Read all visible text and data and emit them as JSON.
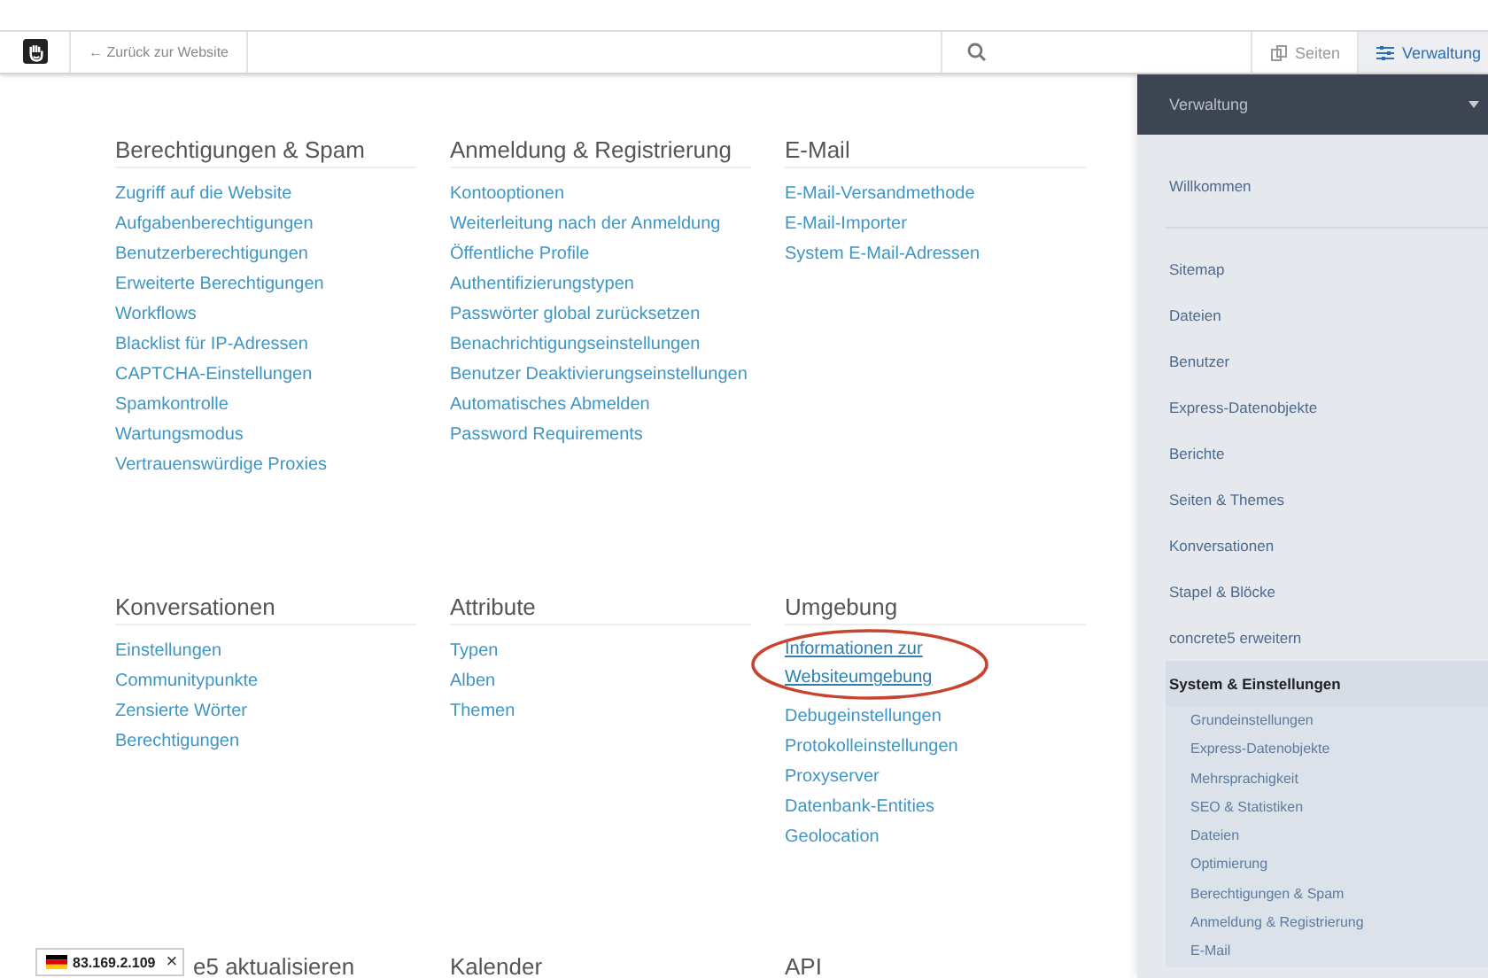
{
  "toolbar": {
    "back_link": "← Zurück zur Website",
    "buttons": [
      {
        "label": "Seiten",
        "kind": "pages",
        "selected": false
      },
      {
        "label": "Verwaltung",
        "kind": "dashboard",
        "selected": true
      }
    ]
  },
  "sections": [
    {
      "title": "Berechtigungen & Spam",
      "links": [
        {
          "label": "Zugriff auf die Website"
        },
        {
          "label": "Aufgabenberechtigungen"
        },
        {
          "label": "Benutzerberechtigungen"
        },
        {
          "label": "Erweiterte Berechtigungen"
        },
        {
          "label": "Workflows"
        },
        {
          "label": "Blacklist für IP-Adressen"
        },
        {
          "label": "CAPTCHA-Einstellungen"
        },
        {
          "label": "Spamkontrolle"
        },
        {
          "label": "Wartungsmodus"
        },
        {
          "label": "Vertrauenswürdige Proxies"
        }
      ]
    },
    {
      "title": "Anmeldung & Registrierung",
      "links": [
        {
          "label": "Kontooptionen"
        },
        {
          "label": "Weiterleitung nach der Anmeldung"
        },
        {
          "label": "Öffentliche Profile"
        },
        {
          "label": "Authentifizierungstypen"
        },
        {
          "label": "Passwörter global zurücksetzen"
        },
        {
          "label": "Benachrichtigungseinstellungen"
        },
        {
          "label": "Benutzer Deaktivierungseinstellungen"
        },
        {
          "label": "Automatisches Abmelden"
        },
        {
          "label": "Password Requirements"
        }
      ]
    },
    {
      "title": "E-Mail",
      "links": [
        {
          "label": "E-Mail-Versandmethode"
        },
        {
          "label": "E-Mail-Importer"
        },
        {
          "label": "System E-Mail-Adressen"
        }
      ]
    },
    {
      "title": "Konversationen",
      "links": [
        {
          "label": "Einstellungen"
        },
        {
          "label": "Communitypunkte"
        },
        {
          "label": "Zensierte Wörter"
        },
        {
          "label": "Berechtigungen"
        }
      ]
    },
    {
      "title": "Attribute",
      "links": [
        {
          "label": "Typen"
        },
        {
          "label": "Alben"
        },
        {
          "label": "Themen"
        }
      ]
    },
    {
      "title": "Umgebung",
      "links": [
        {
          "label": "Informationen zur Websiteumgebung",
          "circled": true
        },
        {
          "label": "Debugeinstellungen",
          "circled": false
        },
        {
          "label": "Protokolleinstellungen",
          "circled": false
        },
        {
          "label": "Proxyserver",
          "circled": false
        },
        {
          "label": "Datenbank-Entities",
          "circled": false
        },
        {
          "label": "Geolocation",
          "circled": false
        }
      ]
    },
    {
      "title": "e5 aktualisieren"
    },
    {
      "title": "Kalender"
    },
    {
      "title": "API"
    }
  ],
  "ip_badge": {
    "label": "83.169.2.109",
    "close": "×"
  },
  "sidebar": {
    "title": "Verwaltung",
    "items": [
      {
        "label": "Willkommen",
        "selected": false
      },
      {
        "label": "Sitemap",
        "selected": false
      },
      {
        "label": "Dateien",
        "selected": false
      },
      {
        "label": "Benutzer",
        "selected": false
      },
      {
        "label": "Express-Datenobjekte",
        "selected": false
      },
      {
        "label": "Berichte",
        "selected": false
      },
      {
        "label": "Seiten & Themes",
        "selected": false
      },
      {
        "label": "Konversationen",
        "selected": false
      },
      {
        "label": "Stapel & Blöcke",
        "selected": false
      },
      {
        "label": "concrete5 erweitern",
        "selected": false
      },
      {
        "label": "System & Einstellungen",
        "selected": true,
        "children": [
          {
            "label": "Grundeinstellungen"
          },
          {
            "label": "Express-Datenobjekte"
          },
          {
            "label": "Mehrsprachigkeit"
          },
          {
            "label": "SEO & Statistiken"
          },
          {
            "label": "Dateien"
          },
          {
            "label": "Optimierung"
          },
          {
            "label": "Berechtigungen & Spam"
          },
          {
            "label": "Anmeldung & Registrierung"
          },
          {
            "label": "E-Mail"
          }
        ]
      }
    ]
  }
}
